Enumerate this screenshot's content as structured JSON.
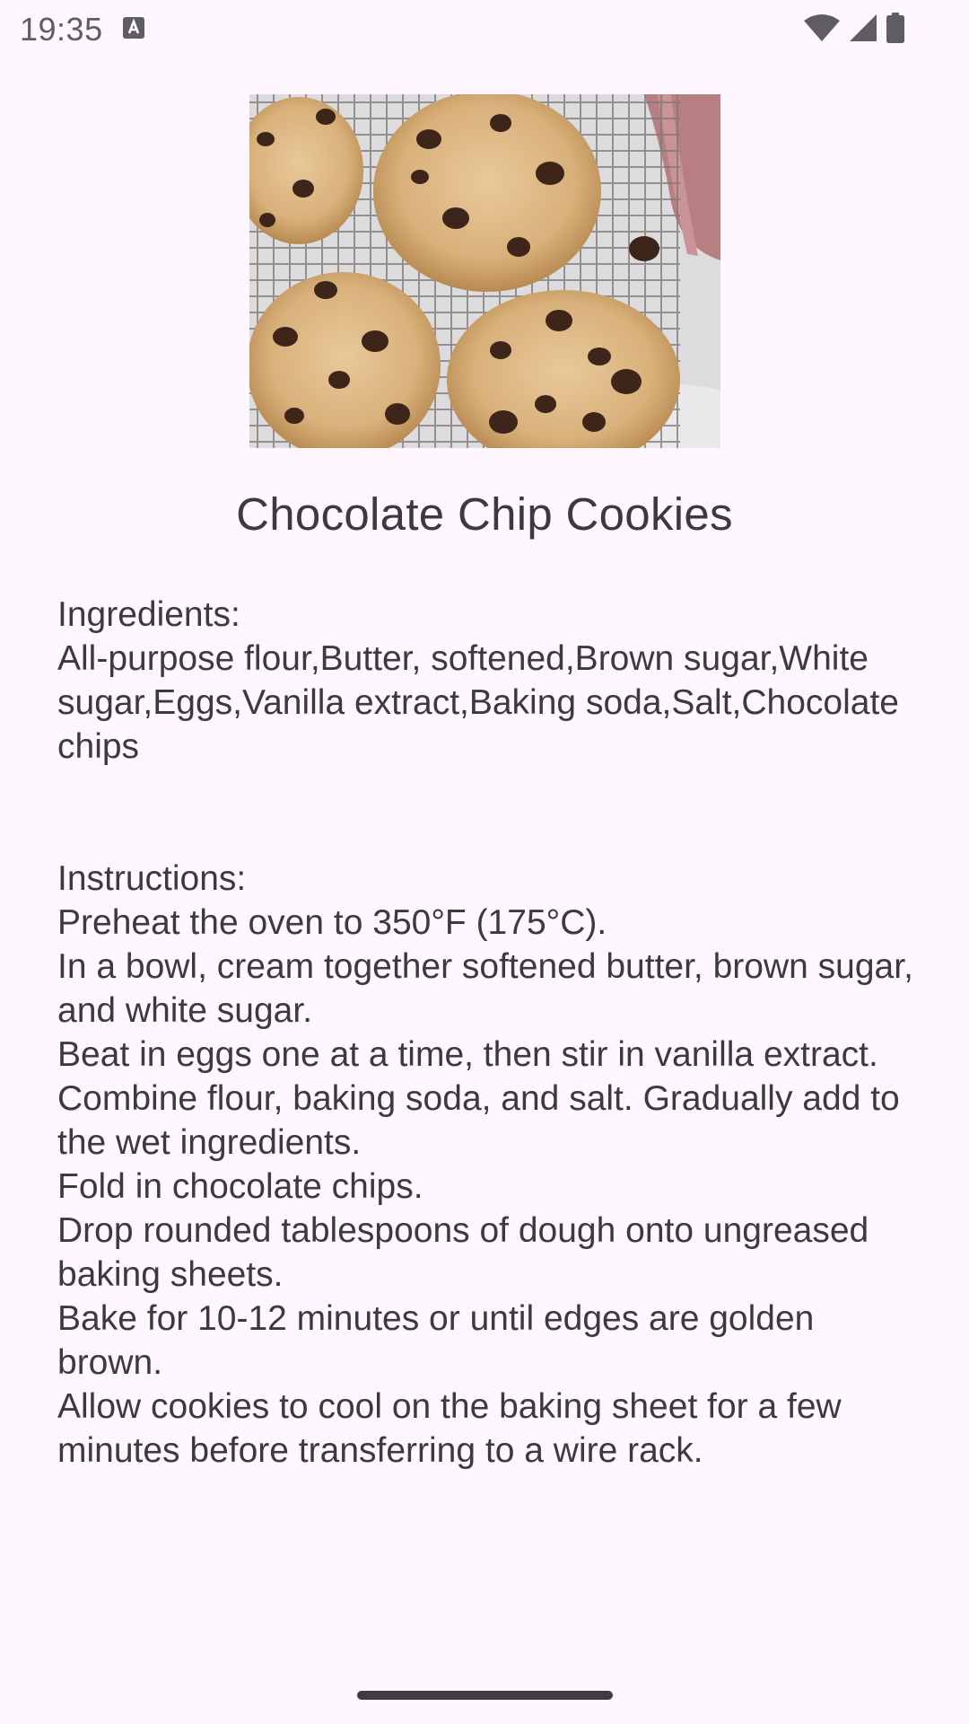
{
  "status_bar": {
    "time": "19:35",
    "icons": [
      "keyboard-a-icon",
      "wifi-icon",
      "signal-icon",
      "battery-icon"
    ]
  },
  "recipe": {
    "image_alt": "Chocolate chip cookies on a cooling rack",
    "title": "Chocolate Chip Cookies",
    "ingredients_heading": "Ingredients:",
    "ingredients_text": "All-purpose flour,Butter, softened,Brown sugar,White sugar,Eggs,Vanilla extract,Baking soda,Salt,Chocolate chips",
    "instructions_heading": "Instructions:",
    "instructions": [
      "Preheat the oven to 350°F (175°C).",
      "In a bowl, cream together softened butter, brown sugar, and white sugar.",
      "Beat in eggs one at a time, then stir in vanilla extract.",
      "Combine flour, baking soda, and salt. Gradually add to the wet ingredients.",
      "Fold in chocolate chips.",
      "Drop rounded tablespoons of dough onto ungreased baking sheets.",
      "Bake for 10-12 minutes or until edges are golden brown.",
      "Allow cookies to cool on the baking sheet for a few minutes before transferring to a wire rack."
    ]
  },
  "colors": {
    "background": "#FEF7FF",
    "text": "#3b3a3e"
  }
}
